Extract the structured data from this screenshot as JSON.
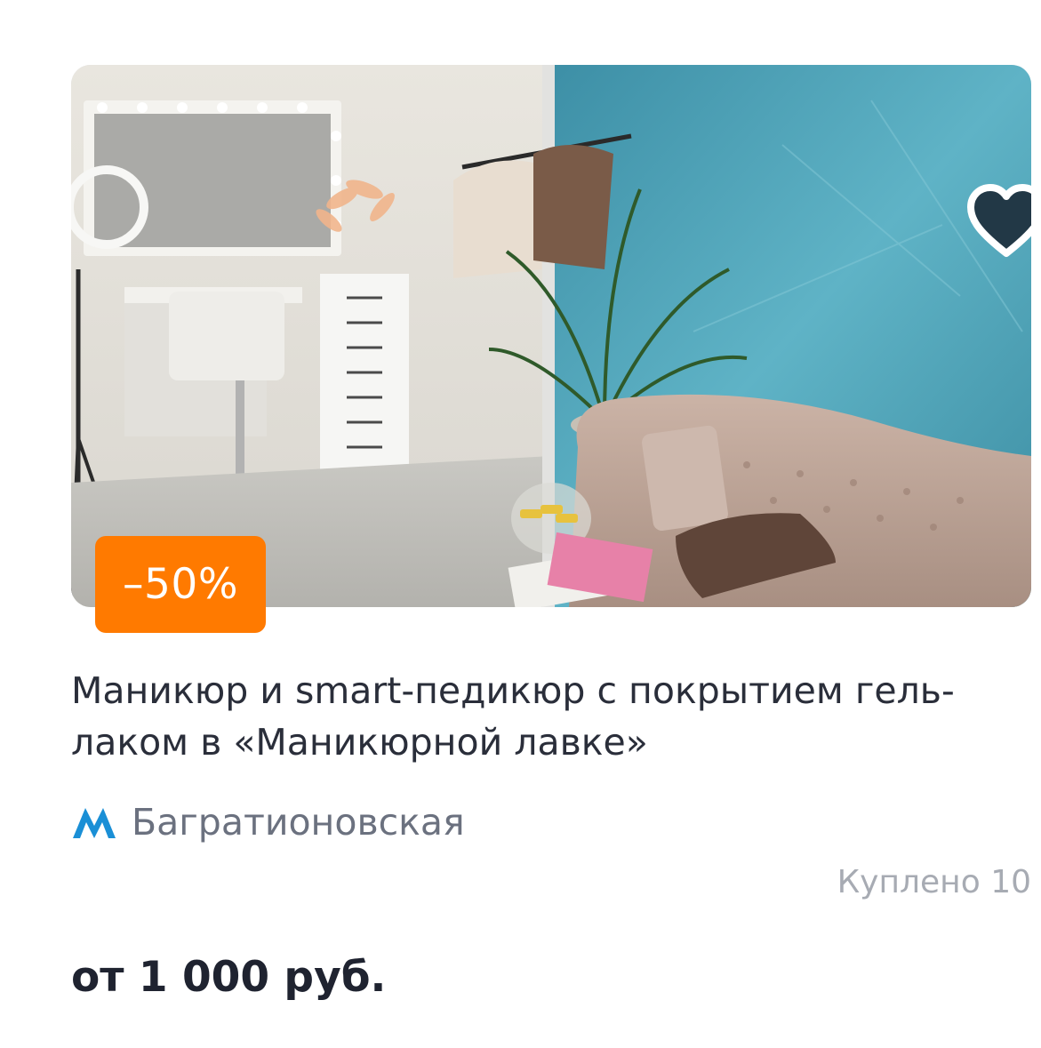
{
  "card": {
    "image_alt": "salon interior",
    "discount_badge": "–50%",
    "title": "Маникюр и smart-педикюр с покрытием гель-лаком в «Маникюрной лавке»",
    "metro": {
      "icon": "metro-icon",
      "station": "Багратионовская",
      "color": "#1a8fd6"
    },
    "bought_text": "Куплено 10",
    "price_text": "от 1 000 руб.",
    "favorite_icon": "heart-icon"
  },
  "colors": {
    "accent": "#ff7a00",
    "text": "#2a2e3a",
    "muted": "#6b717f",
    "light": "#a7abb3"
  }
}
